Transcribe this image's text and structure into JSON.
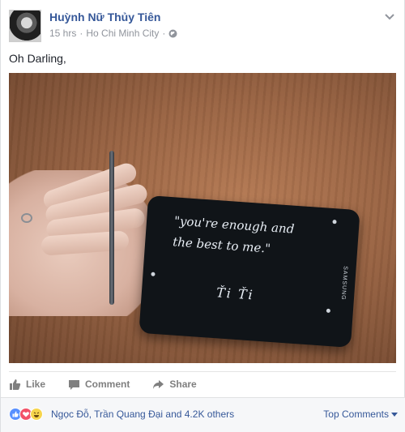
{
  "post": {
    "author": "Huỳnh Nữ Thủy Tiên",
    "time": "15 hrs",
    "separator": "·",
    "location": "Ho Chi Minh City",
    "separator2": "·",
    "text": "Oh Darling,"
  },
  "photo": {
    "handwriting_line1": "\"you're enough and",
    "handwriting_line2": "the best to me.\"",
    "signature": "Ťi Ťi",
    "brand": "SAMSUNG"
  },
  "actions": {
    "like": "Like",
    "comment": "Comment",
    "share": "Share"
  },
  "reactions": {
    "summary": "Ngọc Đỗ, Trần Quang Đại and 4.2K others",
    "top_comments": "Top Comments",
    "types": [
      "like-icon",
      "love-icon",
      "haha-icon"
    ]
  },
  "colors": {
    "link": "#365899",
    "meta": "#90949c",
    "action": "#7f7f7f",
    "like": "#5890ff",
    "love": "#f25268",
    "haha": "#f7d54c"
  }
}
